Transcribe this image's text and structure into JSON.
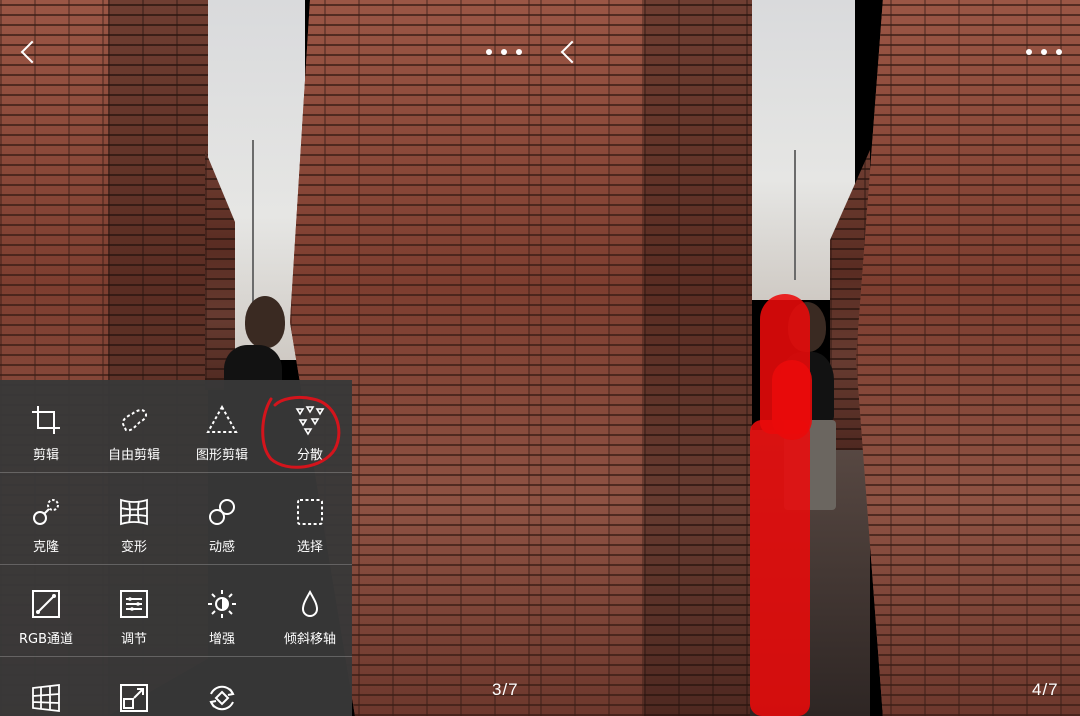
{
  "left_screen": {
    "page_indicator": "3/7",
    "tools_menu": {
      "rows": [
        [
          {
            "label": "剪辑",
            "icon": "crop-icon"
          },
          {
            "label": "自由剪辑",
            "icon": "freeform-cut-icon"
          },
          {
            "label": "图形剪辑",
            "icon": "triangle-shape-icon"
          },
          {
            "label": "分散",
            "icon": "scatter-icon"
          }
        ],
        [
          {
            "label": "克隆",
            "icon": "clone-icon"
          },
          {
            "label": "变形",
            "icon": "warp-grid-icon"
          },
          {
            "label": "动感",
            "icon": "motion-icon"
          },
          {
            "label": "选择",
            "icon": "selection-icon"
          }
        ],
        [
          {
            "label": "RGB通道",
            "icon": "rgb-channel-icon"
          },
          {
            "label": "调节",
            "icon": "adjust-icon"
          },
          {
            "label": "增强",
            "icon": "enhance-icon"
          },
          {
            "label": "倾斜移轴",
            "icon": "tilt-shift-icon"
          }
        ],
        [
          {
            "label": "",
            "icon": "perspective-grid-icon"
          },
          {
            "label": "",
            "icon": "resize-icon"
          },
          {
            "label": "",
            "icon": "rotate-icon"
          }
        ]
      ],
      "highlighted_tool": "分散",
      "highlight_color": "#d4141c"
    }
  },
  "right_screen": {
    "page_indicator": "4/7",
    "mask_color": "#eb0a0a"
  }
}
